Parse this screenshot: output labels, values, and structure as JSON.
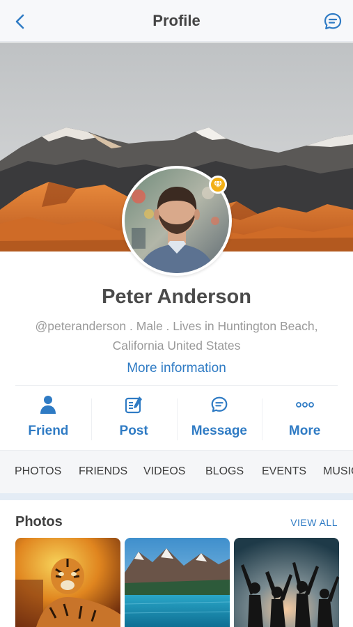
{
  "header": {
    "title": "Profile",
    "back_icon": "chevron-left-icon",
    "chat_icon": "chat-bubble-icon"
  },
  "profile": {
    "name": "Peter Anderson",
    "bio": "@peteranderson . Male . Lives in Huntington Beach, California United States",
    "more_information": "More information",
    "badge_icon": "diamond-icon"
  },
  "actions": [
    {
      "label": "Friend",
      "icon": "person-icon"
    },
    {
      "label": "Post",
      "icon": "edit-post-icon"
    },
    {
      "label": "Message",
      "icon": "chat-icon"
    },
    {
      "label": "More",
      "icon": "ellipsis-icon"
    }
  ],
  "tabs": [
    "PHOTOS",
    "FRIENDS",
    "VIDEOS",
    "BLOGS",
    "EVENTS",
    "MUSIC"
  ],
  "photos": {
    "title": "Photos",
    "view_all": "VIEW ALL"
  },
  "colors": {
    "accent": "#2f7bc4",
    "badge": "#f2b016",
    "header_bg": "#f7f8fa",
    "tabs_bg": "#f5f6f8"
  }
}
